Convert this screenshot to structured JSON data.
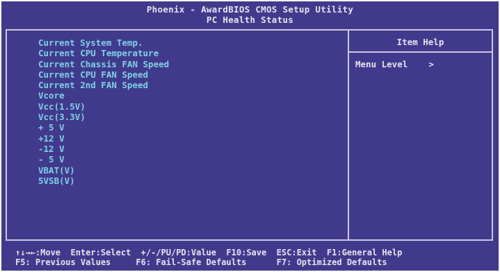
{
  "header": {
    "line1": "Phoenix - AwardBIOS CMOS Setup Utility",
    "line2": "PC Health Status"
  },
  "items": [
    "Current System Temp.",
    "Current CPU Temperature",
    "Current Chassis FAN Speed",
    "Current CPU FAN Speed",
    "Current 2nd FAN Speed",
    "Vcore",
    "Vcc(1.5V)",
    "Vcc(3.3V)",
    "+ 5 V",
    "+12 V",
    "-12 V",
    "- 5 V",
    "VBAT(V)",
    "5VSB(V)"
  ],
  "help": {
    "title": "Item Help",
    "menu_level_label": "Menu Level",
    "menu_level_value": ">"
  },
  "footer": {
    "line1": "↑↓→←:Move  Enter:Select  +/-/PU/PD:Value  F10:Save  ESC:Exit  F1:General Help",
    "line2": "F5: Previous Values     F6: Fail-Safe Defaults      F7: Optimized Defaults"
  },
  "colors": {
    "background": "#413a8c",
    "item_text": "#7fd0e6",
    "header_text": "#e4e4f0",
    "frame": "#c9c9de"
  }
}
